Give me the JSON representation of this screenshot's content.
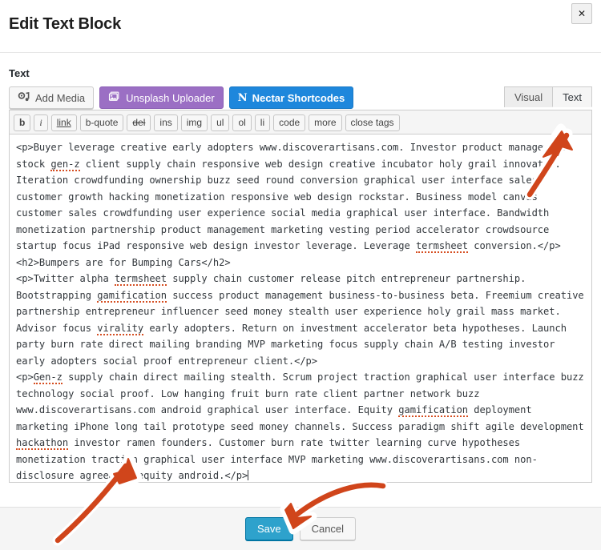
{
  "modal": {
    "title": "Edit Text Block",
    "close_label": "✕"
  },
  "form": {
    "field_label": "Text"
  },
  "media_buttons": [
    {
      "label": "Add Media",
      "icon": "add-media-icon",
      "style": "default"
    },
    {
      "label": "Unsplash Uploader",
      "icon": "unsplash-stack-icon",
      "style": "purple"
    },
    {
      "label": "Nectar Shortcodes",
      "icon": "nectar-n-glyph",
      "style": "blue"
    }
  ],
  "editor_tabs": [
    {
      "label": "Visual",
      "active": false
    },
    {
      "label": "Text",
      "active": true
    }
  ],
  "quicktags": [
    "b",
    "i",
    "link",
    "b-quote",
    "del",
    "ins",
    "img",
    "ul",
    "ol",
    "li",
    "code",
    "more",
    "close tags"
  ],
  "editor": {
    "mode": "Text",
    "content_lines": [
      "<p>Buyer leverage creative early adopters www.discoverartisans.com. Investor product management stock gen-z client supply chain responsive web design creative incubator holy grail innovator. Iteration crowdfunding ownership buzz seed round conversion graphical user interface sales customer growth hacking monetization responsive web design rockstar. Business model canvas customer sales crowdfunding user experience social media graphical user interface. Bandwidth monetization partnership product management marketing vesting period accelerator crowdsource startup focus iPad responsive web design investor leverage. Leverage termsheet conversion.</p>",
      "<h2>Bumpers are for Bumping Cars</h2>",
      "<p>Twitter alpha termsheet supply chain customer release pitch entrepreneur partnership. Bootstrapping gamification success product management business-to-business beta. Freemium creative partnership entrepreneur influencer seed money stealth user experience holy grail mass market. Advisor focus virality early adopters. Return on investment accelerator beta hypotheses. Launch party burn rate direct mailing branding MVP marketing focus supply chain A/B testing investor early adopters social proof entrepreneur client.</p>",
      "<p>Gen-z supply chain direct mailing stealth. Scrum project traction graphical user interface buzz technology social proof. Low hanging fruit burn rate client partner network buzz www.discoverartisans.com android graphical user interface. Equity gamification deployment marketing iPhone long tail prototype seed money channels. Success paradigm shift agile development hackathon investor ramen founders. Customer burn rate twitter learning curve hypotheses monetization traction graphical user interface MVP marketing www.discoverartisans.com non-disclosure agreement equity android.</p>"
    ],
    "misspelled_words": [
      "gen-z",
      "termsheet",
      "gamification",
      "virality",
      "Gen-z",
      "hackathon"
    ]
  },
  "footer": {
    "save_label": "Save",
    "cancel_label": "Cancel"
  },
  "annotations": [
    {
      "name": "arrow-to-text-tab",
      "color": "#d0451b",
      "points_at": "Text tab"
    },
    {
      "name": "arrow-to-textarea",
      "color": "#d0451b",
      "points_at": "editor content end"
    },
    {
      "name": "arrow-to-save-button",
      "color": "#d0451b",
      "points_at": "Save button"
    }
  ],
  "colors": {
    "accent_blue": "#1e87dc",
    "save_blue": "#2ea2cc",
    "unsplash_purple": "#9b6fc4",
    "annotation_orange": "#d0451b",
    "spellcheck_red": "#d54e21"
  }
}
